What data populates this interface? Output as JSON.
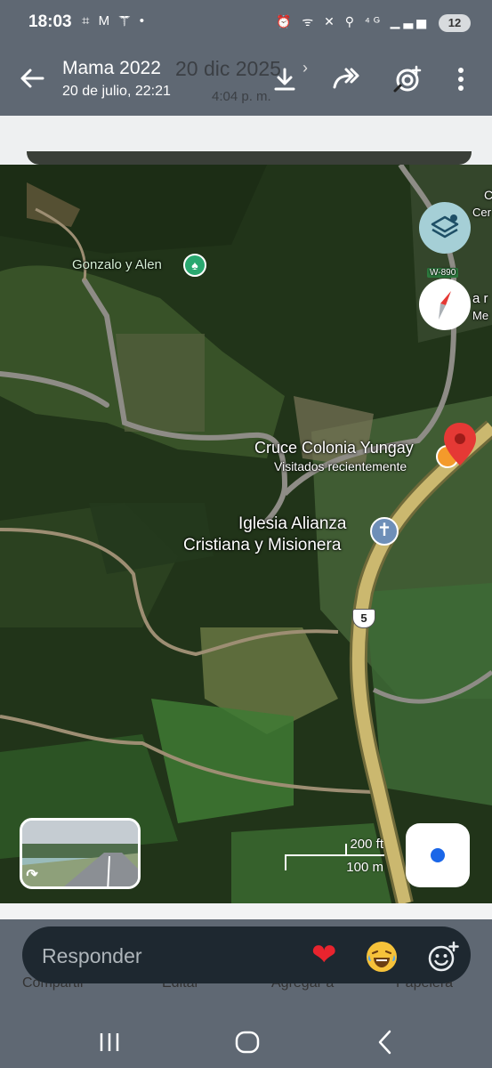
{
  "status_bar": {
    "time": "18:03",
    "left_icons": "⌗ M ☤ •",
    "right_icons": "⏰ ᯤ ✕ ⚲ ⁴ᴳ ▁▃▅",
    "battery": "12"
  },
  "header": {
    "title": "Mama 2022",
    "subtitle": "20 de julio, 22:21",
    "ghost_date": "20 dic 2025",
    "ghost_chevron": "›",
    "ghost_time": "4:04 p. m.",
    "icons": [
      "back-arrow-icon",
      "download-icon",
      "share-icon",
      "lens-icon",
      "more-icon"
    ]
  },
  "map": {
    "places": {
      "gonzalo": "Gonzalo y Alen",
      "cruce": "Cruce Colonia Yungay",
      "cruce_sub": "Visitados recientemente",
      "iglesia_line1": "Iglesia Alianza",
      "iglesia_line2": "Cristiana y Misionera",
      "edge_c": "C",
      "edge_cer": "Cer",
      "edge_a": "a r",
      "edge_me": "Me",
      "road_w": "W-890"
    },
    "route_number": "5",
    "scale": {
      "feet": "200 ft",
      "meters": "100 m"
    },
    "colors": {
      "pin": "#e53935",
      "forest": "#24361c",
      "road": "#c9b56a"
    }
  },
  "reply": {
    "placeholder": "Responder",
    "heart": "❤",
    "icons": [
      "heart-emoji",
      "laughing-emoji",
      "add-emoji-icon"
    ]
  },
  "ghost_actions": [
    "Compartir",
    "Editar",
    "Agregar a",
    "Papelera"
  ],
  "navbar": [
    "recent-apps-icon",
    "home-icon",
    "back-icon"
  ]
}
